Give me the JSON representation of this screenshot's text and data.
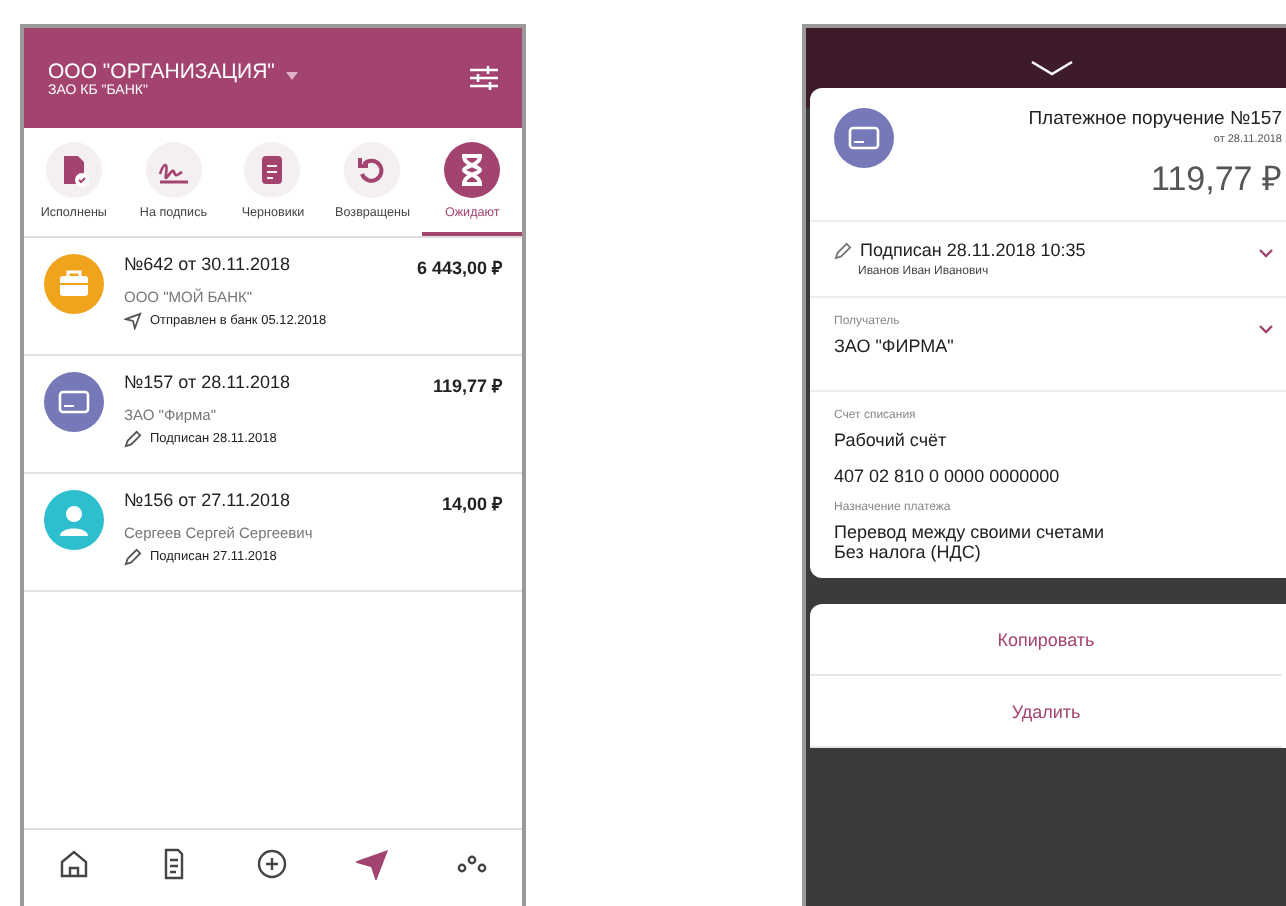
{
  "left": {
    "header": {
      "org": "ООО \"ОРГАНИЗАЦИЯ\"",
      "bank": "ЗАО КБ \"БАНК\""
    },
    "tabs": [
      {
        "label": "Исполнены",
        "kind": "done",
        "selected": false
      },
      {
        "label": "На подпись",
        "kind": "sign",
        "selected": false
      },
      {
        "label": "Черновики",
        "kind": "draft",
        "selected": false
      },
      {
        "label": "Возвращены",
        "kind": "returned",
        "selected": false
      },
      {
        "label": "Ожидают",
        "kind": "waiting",
        "selected": true
      }
    ],
    "documents": [
      {
        "kind": "briefcase",
        "color": "#f0a31c",
        "title": "№642 от 30.11.2018",
        "amount": "6 443,00 ₽",
        "counterparty": "ООО \"МОЙ БАНК\"",
        "status": {
          "kind": "sent",
          "text": "Отправлен в банк 05.12.2018"
        }
      },
      {
        "kind": "card",
        "color": "#7679b8",
        "title": "№157 от 28.11.2018",
        "amount": "119,77 ₽",
        "counterparty": "ЗАО \"Фирма\"",
        "status": {
          "kind": "signed",
          "text": "Подписан 28.11.2018"
        }
      },
      {
        "kind": "person",
        "color": "#2ebfcf",
        "title": "№156 от 27.11.2018",
        "amount": "14,00 ₽",
        "counterparty": "Сергеев Сергей Сергеевич",
        "status": {
          "kind": "signed",
          "text": "Подписан 27.11.2018"
        }
      }
    ],
    "nav": [
      {
        "kind": "home",
        "selected": false
      },
      {
        "kind": "document",
        "selected": false
      },
      {
        "kind": "plus",
        "selected": false
      },
      {
        "kind": "send",
        "selected": true
      },
      {
        "kind": "more",
        "selected": false
      }
    ]
  },
  "right": {
    "title": "Платежное поручение №157",
    "date": "от 28.11.2018",
    "amount": "119,77 ₽",
    "signature": {
      "status": "Подписан 28.11.2018 10:35",
      "signer": "Иванов Иван Иванович"
    },
    "recipient": {
      "label": "Получатель",
      "value": "ЗАО \"ФИРМА\""
    },
    "account": {
      "label": "Счет списания",
      "name": "Рабочий счёт",
      "number": "407 02 810 0 0000 0000000"
    },
    "purpose": {
      "label": "Назначение платежа",
      "lines": [
        "Перевод между своими счетами",
        "Без налога (НДС)"
      ]
    },
    "actions": [
      "Копировать",
      "Удалить"
    ]
  }
}
